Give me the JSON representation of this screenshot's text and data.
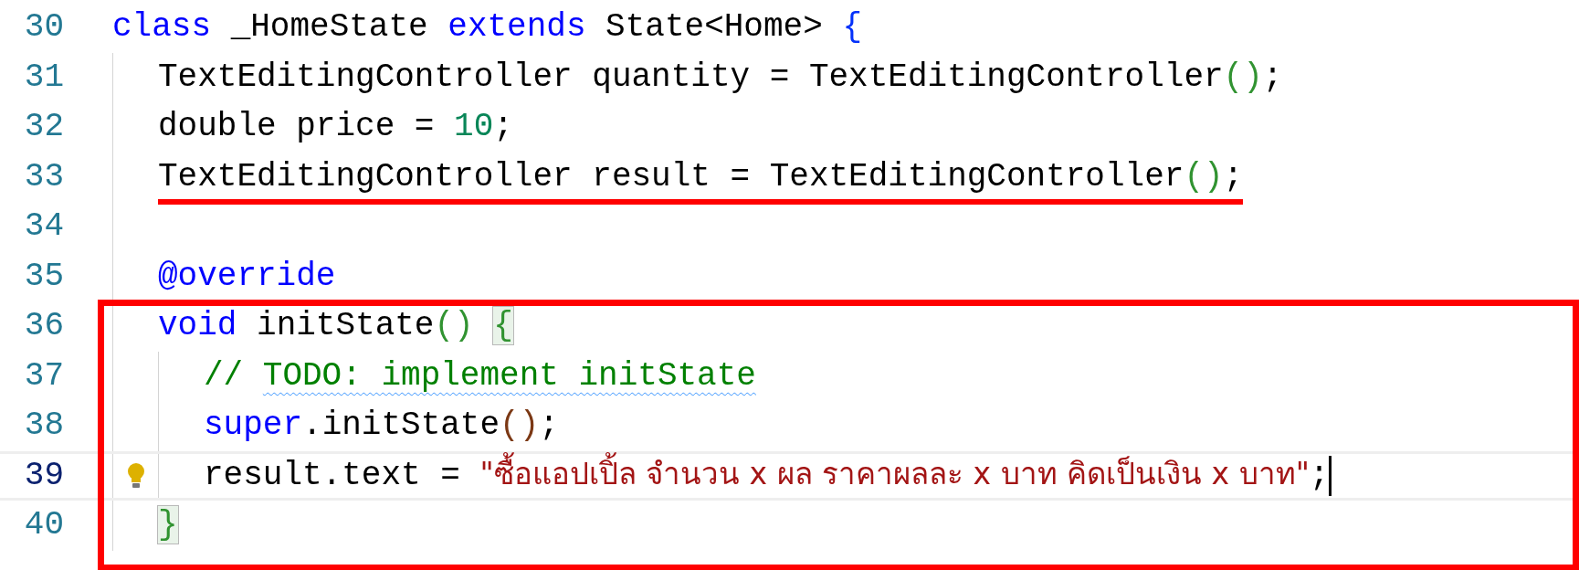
{
  "lines": [
    {
      "number": "30",
      "underlined": false,
      "boxed": false,
      "current": false,
      "lightbulb": false,
      "tokens": [
        {
          "kind": "keyword",
          "text": "class"
        },
        {
          "kind": "plain",
          "text": " _HomeState "
        },
        {
          "kind": "keyword",
          "text": "extends"
        },
        {
          "kind": "plain",
          "text": " State<Home> "
        },
        {
          "kind": "bracket-a",
          "text": "{"
        }
      ],
      "children": [
        {
          "number": "31",
          "underlined": false,
          "boxed": false,
          "current": false,
          "lightbulb": false,
          "tokens": [
            {
              "kind": "plain",
              "text": "TextEditingController quantity = TextEditingController"
            },
            {
              "kind": "bracket-b",
              "text": "()"
            },
            {
              "kind": "plain",
              "text": ";"
            }
          ]
        },
        {
          "number": "32",
          "underlined": false,
          "boxed": false,
          "current": false,
          "lightbulb": false,
          "tokens": [
            {
              "kind": "plain",
              "text": "double price = "
            },
            {
              "kind": "number",
              "text": "10"
            },
            {
              "kind": "plain",
              "text": ";"
            }
          ]
        },
        {
          "number": "33",
          "underlined": true,
          "boxed": false,
          "current": false,
          "lightbulb": false,
          "tokens": [
            {
              "kind": "plain",
              "text": "TextEditingController result = TextEditingController"
            },
            {
              "kind": "bracket-b",
              "text": "()"
            },
            {
              "kind": "plain",
              "text": ";"
            }
          ]
        },
        {
          "number": "34",
          "underlined": false,
          "boxed": false,
          "current": false,
          "lightbulb": false
        },
        {
          "number": "35",
          "underlined": false,
          "boxed": false,
          "current": false,
          "lightbulb": false,
          "tokens": [
            {
              "kind": "keyword",
              "text": "@override"
            }
          ]
        },
        {
          "number": "36",
          "underlined": false,
          "boxed": true,
          "current": false,
          "lightbulb": false,
          "tokens": [
            {
              "kind": "keyword",
              "text": "void"
            },
            {
              "kind": "plain",
              "text": " initState"
            },
            {
              "kind": "bracket-b",
              "text": "() "
            },
            {
              "kind": "bracket-b",
              "text": "{",
              "matched": true
            }
          ],
          "children": [
            {
              "number": "37",
              "underlined": false,
              "boxed": false,
              "current": false,
              "lightbulb": false,
              "tokens": [
                {
                  "kind": "comment",
                  "text": "// "
                },
                {
                  "kind": "comment",
                  "text": "TODO: implement initState",
                  "squiggle": true
                }
              ]
            },
            {
              "number": "38",
              "underlined": false,
              "boxed": false,
              "current": false,
              "lightbulb": false,
              "tokens": [
                {
                  "kind": "keyword",
                  "text": "super"
                },
                {
                  "kind": "plain",
                  "text": ".initState"
                },
                {
                  "kind": "bracket-c",
                  "text": "()"
                },
                {
                  "kind": "plain",
                  "text": ";"
                }
              ]
            },
            {
              "number": "39",
              "underlined": false,
              "boxed": false,
              "current": true,
              "lightbulb": true,
              "tokens": [
                {
                  "kind": "plain",
                  "text": "result.text = "
                },
                {
                  "kind": "string",
                  "text": "\"ซื้อแอปเปิ้ล จำนวน x ผล ราคาผลละ x บาท คิดเป็นเงิน x บาท\""
                },
                {
                  "kind": "plain",
                  "text": ";"
                }
              ]
            }
          ],
          "closing": {
            "number": "40",
            "tokens": [
              {
                "kind": "bracket-b",
                "text": "}",
                "matched": true
              }
            ]
          }
        }
      ]
    }
  ]
}
